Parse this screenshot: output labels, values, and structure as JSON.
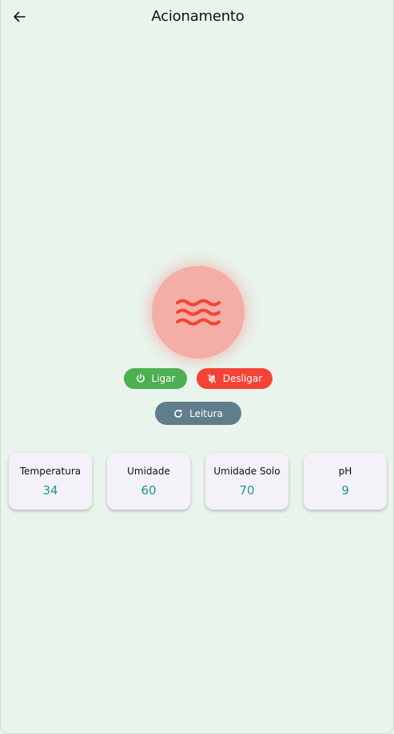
{
  "app_bar": {
    "title": "Acionamento",
    "back_icon": "arrow-left-icon"
  },
  "pump": {
    "icon": "water-waves-icon",
    "state_color": "#f44336",
    "circle_color": "#f4aea6"
  },
  "controls": {
    "on_label": "Ligar",
    "on_icon": "power-icon",
    "on_color": "#4caf50",
    "off_label": "Desligar",
    "off_icon": "power-off-icon",
    "off_color": "#f44336",
    "read_label": "Leitura",
    "read_icon": "refresh-icon",
    "read_color": "#607d8b"
  },
  "sensors": [
    {
      "label": "Temperatura",
      "value": "34"
    },
    {
      "label": "Umidade",
      "value": "60"
    },
    {
      "label": "Umidade Solo",
      "value": "70"
    },
    {
      "label": "pH",
      "value": "9"
    }
  ],
  "colors": {
    "background": "#e8f4ec",
    "card_background": "#f4f1f8",
    "value_color": "#1c9a8e"
  }
}
